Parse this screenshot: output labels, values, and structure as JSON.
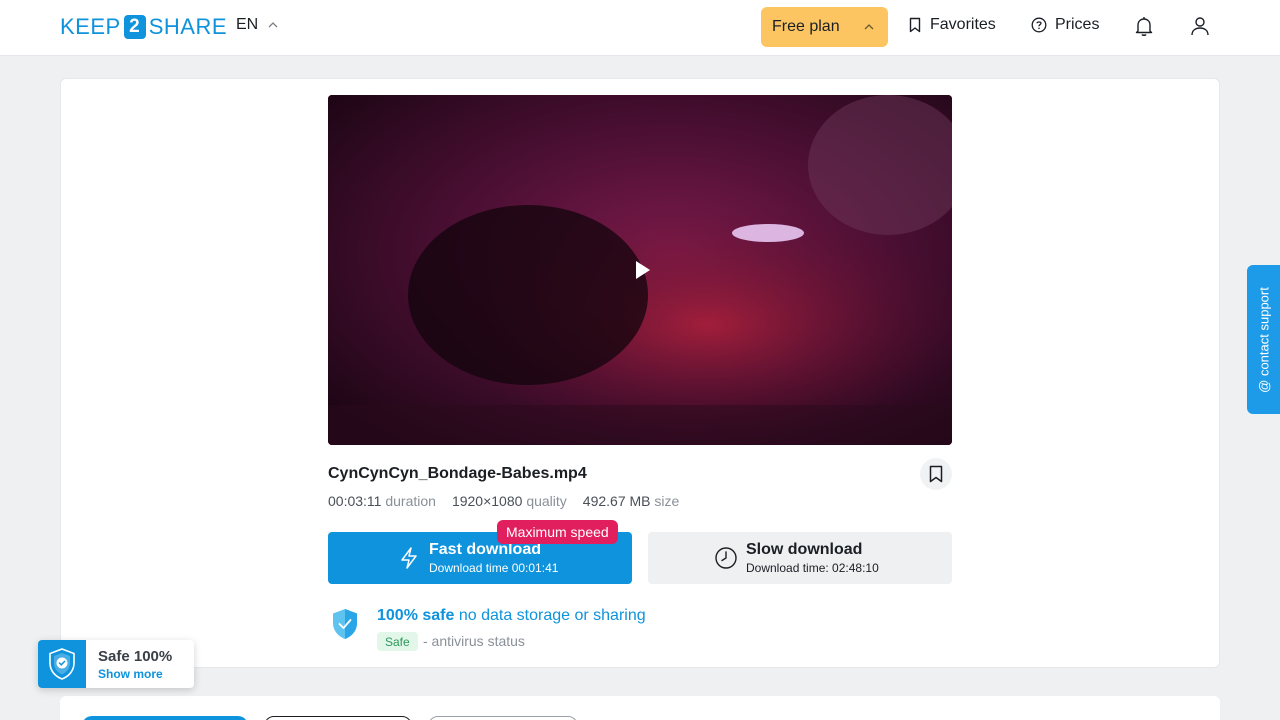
{
  "header": {
    "logo_left": "KEEP",
    "logo_mid": "2",
    "logo_right": "SHARE",
    "language": "EN",
    "plan_label": "Free plan",
    "favorites_label": "Favorites",
    "prices_label": "Prices"
  },
  "file": {
    "name": "CynCynCyn_Bondage-Babes.mp4",
    "duration_value": "00:03:11",
    "duration_unit": "duration",
    "quality_value": "1920×1080",
    "quality_unit": "quality",
    "size_value": "492.67 MB",
    "size_unit": "size"
  },
  "downloads": {
    "max_speed_badge": "Maximum speed",
    "fast_title": "Fast download",
    "fast_time": "Download time 00:01:41",
    "slow_title": "Slow download",
    "slow_time": "Download time: 02:48:10"
  },
  "safety": {
    "headline_strong": "100% safe",
    "headline_rest": "no data storage or sharing",
    "tag": "Safe",
    "status": "- antivirus status"
  },
  "support_label": "@ contact support",
  "safe_widget": {
    "title": "Safe 100%",
    "link": "Show more"
  },
  "colors": {
    "brand": "#0e93dc",
    "plan": "#fdc561",
    "badge": "#e21f5e",
    "safe_tag_bg": "#e2f6ea"
  }
}
